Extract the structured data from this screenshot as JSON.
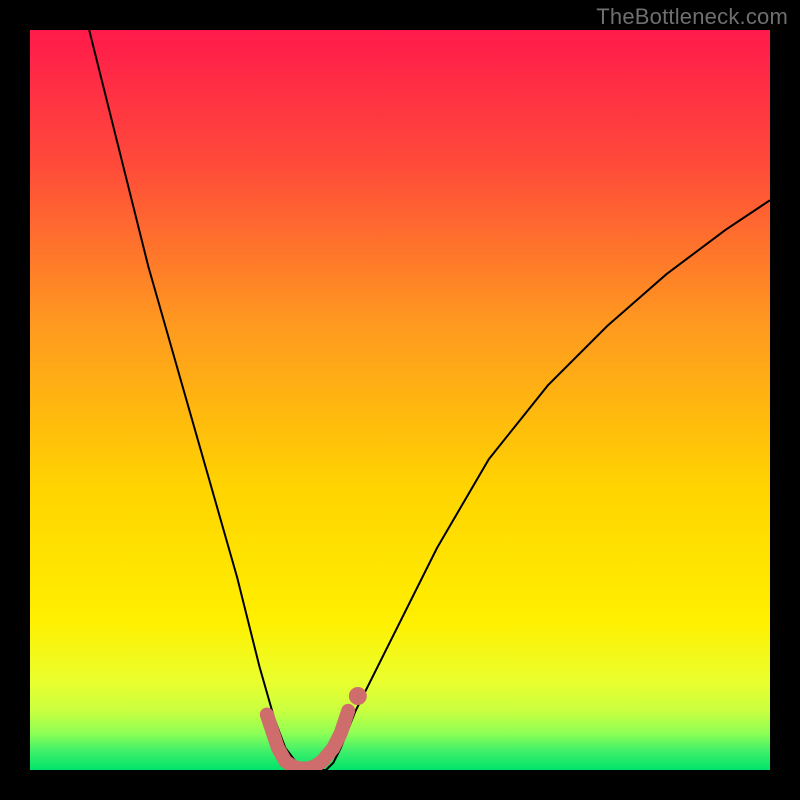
{
  "watermark": "TheBottleneck.com",
  "chart_data": {
    "type": "line",
    "title": "",
    "xlabel": "",
    "ylabel": "",
    "xlim": [
      0,
      100
    ],
    "ylim": [
      0,
      100
    ],
    "grid": false,
    "background_gradient": {
      "top": "#ff1a4b",
      "mid": "#ffd400",
      "green_band_top": "#e8ff33",
      "green_band_bottom": "#00e36b"
    },
    "series": [
      {
        "name": "bottleneck-curve",
        "x": [
          8,
          12,
          16,
          20,
          24,
          28,
          31,
          33,
          34.5,
          36,
          37,
          40,
          41,
          42,
          44,
          48,
          55,
          62,
          70,
          78,
          86,
          94,
          100
        ],
        "y": [
          100,
          84,
          68,
          54,
          40,
          26,
          14,
          7,
          3,
          1,
          0,
          0,
          1,
          3,
          8,
          16,
          30,
          42,
          52,
          60,
          67,
          73,
          77
        ],
        "color": "#000000",
        "stroke_width": 2
      },
      {
        "name": "u-marker",
        "x": [
          32.0,
          33.5,
          34.5,
          35.5,
          36.5,
          37.5,
          38.5,
          39.5,
          41.0,
          42.0,
          43.0
        ],
        "y": [
          7.5,
          3.0,
          1.2,
          0.5,
          0.2,
          0.2,
          0.5,
          1.2,
          3.0,
          5.0,
          8.0
        ],
        "color": "#cf6d6d",
        "stroke_width": 14,
        "marker": "round"
      },
      {
        "name": "u-marker-dot",
        "x": [
          44.3
        ],
        "y": [
          10.0
        ],
        "color": "#cf6d6d",
        "marker": "circle",
        "marker_radius": 9
      }
    ]
  }
}
